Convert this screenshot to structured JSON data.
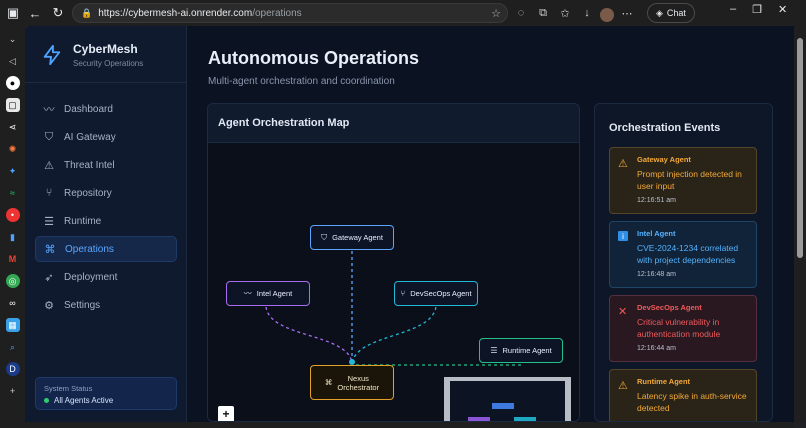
{
  "browser": {
    "url_host": "https://cybermesh-ai.onrender.com",
    "url_path": "/operations",
    "chat_label": "Chat"
  },
  "sidebar": {
    "brand_name": "CyberMesh",
    "brand_sub": "Security Operations",
    "items": [
      {
        "label": "Dashboard",
        "icon": "activity-icon",
        "active": false
      },
      {
        "label": "AI Gateway",
        "icon": "shield-icon",
        "active": false
      },
      {
        "label": "Threat Intel",
        "icon": "alert-triangle-icon",
        "active": false
      },
      {
        "label": "Repository",
        "icon": "git-branch-icon",
        "active": false
      },
      {
        "label": "Runtime",
        "icon": "server-icon",
        "active": false
      },
      {
        "label": "Operations",
        "icon": "workflow-icon",
        "active": true
      },
      {
        "label": "Deployment",
        "icon": "rocket-icon",
        "active": false
      },
      {
        "label": "Settings",
        "icon": "gear-icon",
        "active": false
      }
    ],
    "status_title": "System Status",
    "status_value": "All Agents Active"
  },
  "main": {
    "title": "Autonomous Operations",
    "subtitle": "Multi-agent orchestration and coordination"
  },
  "map": {
    "title": "Agent Orchestration Map",
    "agents": {
      "gateway": "Gateway Agent",
      "intel": "Intel Agent",
      "devsecops": "DevSecOps Agent",
      "runtime": "Runtime Agent",
      "nexus_line1": "Nexus",
      "nexus_line2": "Orchestrator"
    },
    "colors": {
      "gateway": "#5ea4ff",
      "intel": "#a86cf0",
      "devsecops": "#23b8d6",
      "runtime": "#24c08a",
      "nexus": "#e2a227"
    }
  },
  "events": {
    "title": "Orchestration Events",
    "items": [
      {
        "agent": "Gateway Agent",
        "message": "Prompt injection detected in user input",
        "time": "12:16:51 am",
        "kind": "warn"
      },
      {
        "agent": "Intel Agent",
        "message": "CVE-2024-1234 correlated with project dependencies",
        "time": "12:16:48 am",
        "kind": "info"
      },
      {
        "agent": "DevSecOps Agent",
        "message": "Critical vulnerability in authentication module",
        "time": "12:16:44 am",
        "kind": "err"
      },
      {
        "agent": "Runtime Agent",
        "message": "Latency spike in auth-service detected",
        "time": "",
        "kind": "warn"
      }
    ]
  }
}
